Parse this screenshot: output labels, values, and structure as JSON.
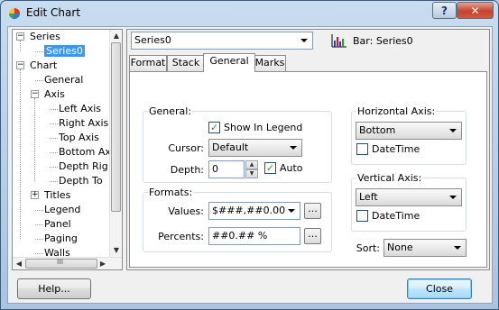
{
  "window": {
    "title": "Edit Chart",
    "help_glyph": "?",
    "close_glyph": "✕"
  },
  "tree": {
    "items": [
      {
        "label": "Series",
        "expander": "−"
      },
      {
        "label": "Series0",
        "selected": true
      },
      {
        "label": "Chart",
        "expander": "−"
      },
      {
        "label": "General"
      },
      {
        "label": "Axis",
        "expander": "−"
      },
      {
        "label": "Left Axis"
      },
      {
        "label": "Right Axis"
      },
      {
        "label": "Top Axis"
      },
      {
        "label": "Bottom Ax"
      },
      {
        "label": "Depth Rig"
      },
      {
        "label": "Depth To"
      },
      {
        "label": "Titles",
        "expander": "+"
      },
      {
        "label": "Legend"
      },
      {
        "label": "Panel"
      },
      {
        "label": "Paging"
      },
      {
        "label": "Walls"
      }
    ],
    "hscroll_grip": "III"
  },
  "series_select": {
    "value": "Series0"
  },
  "series_info": {
    "label": "Bar: Series0"
  },
  "tabs": [
    "Format",
    "Stack",
    "General",
    "Marks"
  ],
  "active_tab": "General",
  "general": {
    "group_label": "General:",
    "show_in_legend": {
      "label": "Show In Legend",
      "checked": true
    },
    "cursor": {
      "label": "Cursor:",
      "value": "Default"
    },
    "depth": {
      "label": "Depth:",
      "value": "0"
    },
    "auto": {
      "label": "Auto",
      "checked": true
    }
  },
  "formats": {
    "group_label": "Formats:",
    "values": {
      "label": "Values:",
      "value": "$###,##0.00"
    },
    "percents": {
      "label": "Percents:",
      "value": "##0.## %"
    },
    "ellipsis": "..."
  },
  "horizontal_axis": {
    "group_label": "Horizontal Axis:",
    "value": "Bottom",
    "datetime": {
      "label": "DateTime",
      "checked": false
    }
  },
  "vertical_axis": {
    "group_label": "Vertical Axis:",
    "value": "Left",
    "datetime": {
      "label": "DateTime",
      "checked": false
    }
  },
  "sort": {
    "label": "Sort:",
    "value": "None"
  },
  "buttons": {
    "help": "Help...",
    "close": "Close"
  }
}
